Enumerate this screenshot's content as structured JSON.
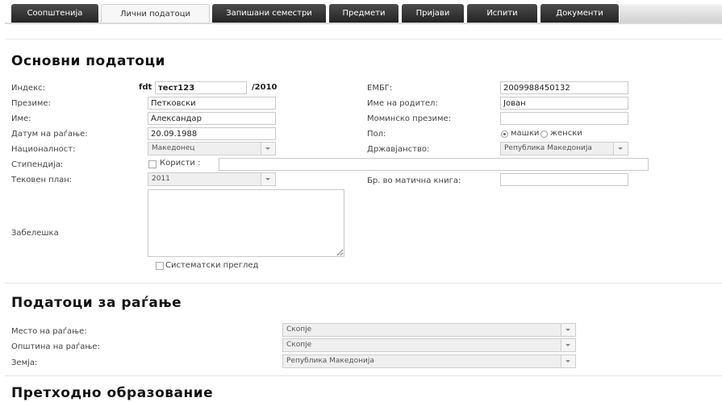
{
  "tabs": [
    {
      "label": "Соопштенија"
    },
    {
      "label": "Лични податоци"
    },
    {
      "label": "Запишани семестри"
    },
    {
      "label": "Предмети"
    },
    {
      "label": "Пријави"
    },
    {
      "label": "Испити"
    },
    {
      "label": "Документи"
    }
  ],
  "active_tab": "Лични податоци",
  "basic": {
    "title": "Основни податоци",
    "index_label": "Индекс:",
    "index_prefix": "fdt",
    "index_value": "тест123",
    "index_suffix": "/2010",
    "embg_label": "ЕМБГ:",
    "embg_value": "2009988450132",
    "surname_label": "Презиме:",
    "surname_value": "Петковски",
    "parent_label": "Име на родител:",
    "parent_value": "Јован",
    "name_label": "Име:",
    "name_value": "Александар",
    "maiden_label": "Моминско презиме:",
    "maiden_value": "",
    "dob_label": "Датум на раѓање:",
    "dob_value": "20.09.1988",
    "gender_label": "Пол:",
    "gender_male": "машки",
    "gender_female": "женски",
    "nationality_label": "Националност:",
    "nationality_value": "Македонец",
    "citizenship_label": "Државјанство:",
    "citizenship_value": "Република Македонија",
    "scholarship_label": "Стипендија:",
    "scholarship_check": "Користи :",
    "scholarship_value": "",
    "plan_label": "Тековен план:",
    "plan_value": "2011",
    "registry_label": "Бр. во матична книга:",
    "registry_value": "",
    "note_label": "Забелешка",
    "note_value": "",
    "checkup_label": "Систематски преглед"
  },
  "birth": {
    "title": "Податоци за раѓање",
    "place_label": "Место на раѓање:",
    "place_value": "Скопје",
    "municipality_label": "Општина на раѓање:",
    "municipality_value": "Скопје",
    "country_label": "Земја:",
    "country_value": "Република Македонија"
  },
  "prev_edu": {
    "title": "Претходно образование"
  }
}
